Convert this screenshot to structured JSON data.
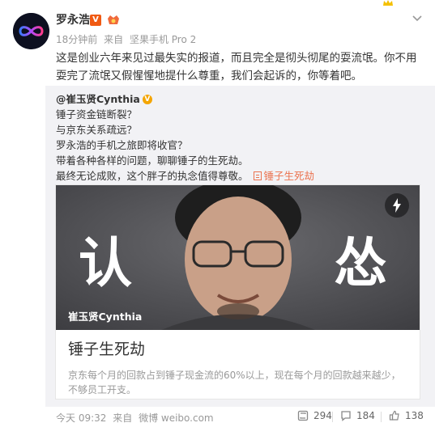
{
  "post": {
    "author": "罗永浩",
    "verified_badge": "V",
    "time": "18分钟前",
    "source_prefix": "来自",
    "source_device": "坚果手机 Pro 2",
    "text": "这是创业六年来见过最失实的报道，而且完全是彻头彻尾的耍流氓。你不用耍完了流氓又假惺惺地提什么尊重，我们会起诉的，你等着吧。"
  },
  "repost": {
    "at_author": "@崔玉贤Cynthia",
    "lines": [
      "锤子资金链断裂？",
      "与京东关系疏远？",
      "罗永浩的手机之旅即将收官？",
      "带着各种各样的问题，聊聊锤子的生死劫。",
      "最终无论成败，这个胖子的执念值得尊敬。"
    ],
    "article_tag": "锤子生死劫",
    "card": {
      "big_left": "认",
      "big_right": "怂",
      "credit": "崔玉贤Cynthia",
      "title": "锤子生死劫",
      "description": "京东每个月的回款占到锤子现金流的60%以上，现在每个月的回款越来越少，不够员工开支。"
    },
    "footer": {
      "time": "今天 09:32",
      "source_prefix": "来自",
      "source": "微博 weibo.com",
      "reposts": "294",
      "comments": "184",
      "likes": "138"
    }
  },
  "colors": {
    "accent_orange": "#eb7350",
    "verified_orange": "#f05a13",
    "yellow_v": "#f4a500",
    "repost_bg": "#f2f2f5"
  },
  "icons": [
    "crown-icon",
    "avatar-infinity",
    "verified-v-icon",
    "vip-icon",
    "chevron-down-icon",
    "yellow-v-icon",
    "article-icon",
    "bolt-icon",
    "repost-icon",
    "comment-icon",
    "like-icon"
  ]
}
